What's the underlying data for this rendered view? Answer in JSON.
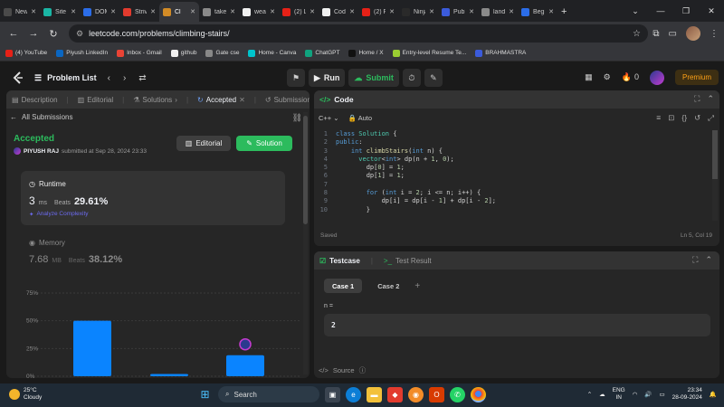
{
  "browser": {
    "tabs": [
      {
        "label": "New C",
        "color": "#4a4a4a"
      },
      {
        "label": "Site o",
        "color": "#1ab5a4"
      },
      {
        "label": "DOM",
        "color": "#2b6de8"
      },
      {
        "label": "Striver",
        "color": "#e23b2e"
      },
      {
        "label": "Cl",
        "color": "#d28b26",
        "active": true
      },
      {
        "label": "takeu",
        "color": "#8a8a8a"
      },
      {
        "label": "weath",
        "color": "#f0f0f0"
      },
      {
        "label": "(2) Lea",
        "color": "#e62117"
      },
      {
        "label": "Codet",
        "color": "#f0f0f0"
      },
      {
        "label": "(2) Re",
        "color": "#e62117"
      },
      {
        "label": "Ninja",
        "color": "#2a2a2a"
      },
      {
        "label": "Public",
        "color": "#3b5bdb"
      },
      {
        "label": "land.b",
        "color": "#8a8a8a"
      },
      {
        "label": "Begin",
        "color": "#2b6de8"
      }
    ],
    "new_tab": "+",
    "url": "leetcode.com/problems/climbing-stairs/",
    "bookmarks": [
      {
        "label": "(4) YouTube",
        "color": "#e62117"
      },
      {
        "label": "Piyush LinkedIn",
        "color": "#0a66c2"
      },
      {
        "label": "Inbox - Gmail",
        "color": "#ea4335"
      },
      {
        "label": "github",
        "color": "#f0f0f0"
      },
      {
        "label": "Gate cse",
        "color": "#888888"
      },
      {
        "label": "Home - Canva",
        "color": "#00c4cc"
      },
      {
        "label": "ChatGPT",
        "color": "#10a37f"
      },
      {
        "label": "Home / X",
        "color": "#111111"
      },
      {
        "label": "Entry-level Resume Te...",
        "color": "#9acd32"
      },
      {
        "label": "BRAHMASTRA",
        "color": "#3b5bdb"
      }
    ]
  },
  "lc_nav": {
    "problem_list": "Problem List",
    "run": "Run",
    "submit": "Submit",
    "streak": "0",
    "premium": "Premium"
  },
  "left": {
    "tabs": {
      "description": "Description",
      "editorial": "Editorial",
      "solutions": "Solutions",
      "accepted": "Accepted",
      "submissions": "Submissions"
    },
    "all_submissions": "All Submissions",
    "status": "Accepted",
    "user": "PIYUSH RAJ",
    "submitted_at": "submitted at Sep 28, 2024 23:33",
    "editorial_btn": "Editorial",
    "solution_btn": "Solution",
    "runtime": {
      "label": "Runtime",
      "value": "3",
      "unit": "ms",
      "beats_label": "Beats",
      "beats": "29.61%",
      "analyze": "Analyze Complexity"
    },
    "memory": {
      "label": "Memory",
      "value": "7.68",
      "unit": "MB",
      "beats_label": "Beats",
      "beats": "38.12%"
    }
  },
  "chart_data": {
    "type": "bar",
    "y_ticks": [
      "75%",
      "50%",
      "25%",
      "0%"
    ],
    "ylim": [
      0,
      75
    ],
    "values": [
      50,
      2,
      19
    ],
    "bar_color": "#0a84ff",
    "marked_bar_index": 2
  },
  "code": {
    "title": "Code",
    "language": "C++",
    "mode": "Auto",
    "lines": [
      [
        [
          "kw",
          "class "
        ],
        [
          "ty",
          "Solution"
        ],
        [
          "tx",
          " {"
        ]
      ],
      [
        [
          "kw",
          "public"
        ],
        [
          "tx",
          ":"
        ]
      ],
      [
        [
          "tx",
          "    "
        ],
        [
          "kw",
          "int "
        ],
        [
          "fn",
          "climbStairs"
        ],
        [
          "tx",
          "("
        ],
        [
          "kw",
          "int "
        ],
        [
          "tx",
          "n) {"
        ]
      ],
      [
        [
          "tx",
          "      "
        ],
        [
          "ty",
          "vector"
        ],
        [
          "tx",
          "<"
        ],
        [
          "kw",
          "int"
        ],
        [
          "tx",
          "> dp(n + "
        ],
        [
          "nu",
          "1"
        ],
        [
          "tx",
          ", "
        ],
        [
          "nu",
          "0"
        ],
        [
          "tx",
          ");"
        ]
      ],
      [
        [
          "tx",
          "        dp["
        ],
        [
          "nu",
          "0"
        ],
        [
          "tx",
          "] = "
        ],
        [
          "nu",
          "1"
        ],
        [
          "tx",
          ";"
        ]
      ],
      [
        [
          "tx",
          "        dp["
        ],
        [
          "nu",
          "1"
        ],
        [
          "tx",
          "] = "
        ],
        [
          "nu",
          "1"
        ],
        [
          "tx",
          ";"
        ]
      ],
      [
        [
          "tx",
          ""
        ]
      ],
      [
        [
          "tx",
          "        "
        ],
        [
          "kw",
          "for "
        ],
        [
          "tx",
          "("
        ],
        [
          "kw",
          "int "
        ],
        [
          "tx",
          "i = "
        ],
        [
          "nu",
          "2"
        ],
        [
          "tx",
          "; i <= n; i++) {"
        ]
      ],
      [
        [
          "tx",
          "            dp[i] = dp[i - "
        ],
        [
          "nu",
          "1"
        ],
        [
          "tx",
          "] + dp[i - "
        ],
        [
          "nu",
          "2"
        ],
        [
          "tx",
          "];"
        ]
      ],
      [
        [
          "tx",
          "        }"
        ]
      ]
    ],
    "status": "Saved",
    "cursor": "Ln 5, Col 19"
  },
  "test": {
    "testcase_tab": "Testcase",
    "result_tab": "Test Result",
    "case1": "Case 1",
    "case2": "Case 2",
    "add": "+",
    "input_label": "n =",
    "input_value": "2",
    "source": "Source"
  },
  "taskbar": {
    "temp": "25°C",
    "condition": "Cloudy",
    "search": "Search",
    "lang1": "ENG",
    "lang2": "IN",
    "time": "23:34",
    "date": "28-09-2024"
  }
}
